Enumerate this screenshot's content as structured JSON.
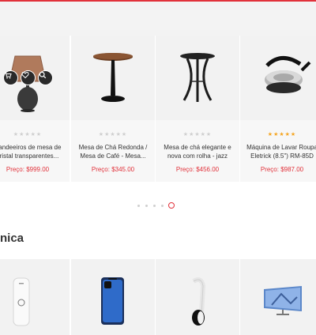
{
  "carousel": {
    "products": [
      {
        "rating_text": "★★★★★",
        "rated": false,
        "title_line1": "Candeeiros de mesa de",
        "title_line2": "cristal transparentes...",
        "price": "Preço: $999.00",
        "image_icon": "table-lamp-icon"
      },
      {
        "rating_text": "★★★★★",
        "rated": false,
        "title_line1": "Mesa de Chá Redonda /",
        "title_line2": "Mesa de Café - Mesa...",
        "price": "Preço: $345.00",
        "image_icon": "round-table-icon"
      },
      {
        "rating_text": "★★★★★",
        "rated": false,
        "title_line1": "Mesa de chá elegante e",
        "title_line2": "nova com rolha - jazz",
        "price": "Preço: $456.00",
        "image_icon": "side-table-icon"
      },
      {
        "rating_text": "★★★★★",
        "rated": true,
        "title_line1": "Máquina de Lavar Roupa",
        "title_line2": "Eletrick (8.5\") RM-85D",
        "price": "Preço: $987.00",
        "image_icon": "roti-maker-icon"
      }
    ],
    "actions": [
      "cart-icon",
      "heart-icon",
      "search-icon"
    ],
    "dots": {
      "count": 5,
      "active_index": 4
    }
  },
  "section": {
    "title": "nica",
    "tiles": [
      "wifi-router-icon",
      "smartphone-icon",
      "headphones-icon",
      "tv-icon"
    ]
  },
  "colors": {
    "accent": "#e1313a",
    "star": "#f5a623"
  }
}
